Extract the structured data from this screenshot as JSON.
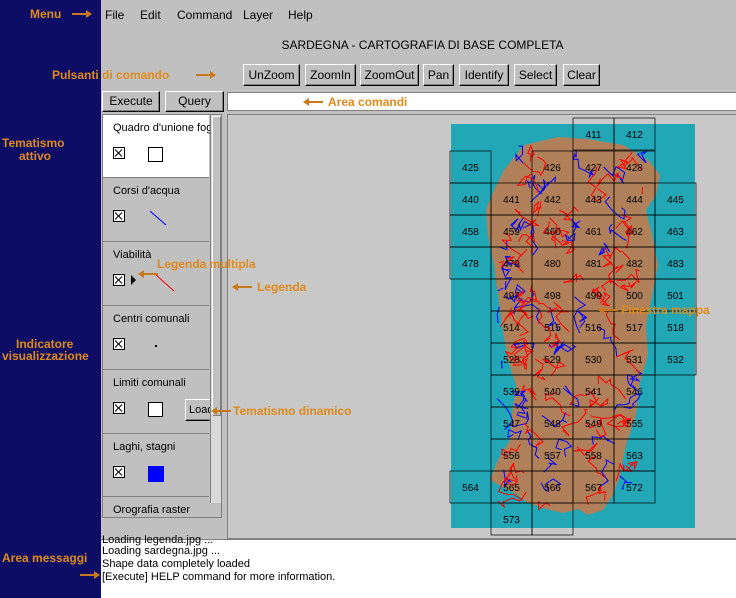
{
  "annotations": {
    "menu": "Menu",
    "pulsanti": "Pulsanti di comando",
    "area_comandi": "Area comandi",
    "tematismo_attivo_1": "Tematismo",
    "tematismo_attivo_2": "attivo",
    "legenda_multipla": "Legenda multipla",
    "legenda": "Legenda",
    "indicatore_1": "Indicatore",
    "indicatore_2": "visualizzazione",
    "tematismo_dinamico": "Tematismo dinamico",
    "finestra_mappa": "Finestra mappa",
    "area_messaggi": "Area messaggi"
  },
  "menubar": {
    "file": "File",
    "edit": "Edit",
    "command": "Command",
    "layer": "Layer",
    "help": "Help"
  },
  "map_title": "SARDEGNA - CARTOGRAFIA DI BASE COMPLETA",
  "toolbar": {
    "unzoom": "UnZoom",
    "zoomin": "ZoomIn",
    "zoomout": "ZoomOut",
    "pan": "Pan",
    "identify": "Identify",
    "select": "Select",
    "clear": "Clear"
  },
  "command_bar": {
    "execute": "Execute",
    "query": "Query",
    "input_value": ""
  },
  "legend": {
    "items": [
      {
        "label": "Quadro d'unione fogli"
      },
      {
        "label": "Corsi d'acqua"
      },
      {
        "label": "Viabilità"
      },
      {
        "label": "Centri comunali"
      },
      {
        "label": "Limiti comunali",
        "load_label": "Load"
      },
      {
        "label": "Laghi, stagni"
      },
      {
        "label": "Orografia raster"
      }
    ]
  },
  "map_sheets": [
    "411",
    "412",
    "425",
    "426",
    "427",
    "428",
    "440",
    "441",
    "442",
    "443",
    "444",
    "445",
    "458",
    "459",
    "460",
    "461",
    "462",
    "463",
    "478",
    "479",
    "480",
    "481",
    "482",
    "483",
    "497",
    "498",
    "499",
    "500",
    "501",
    "514",
    "515",
    "516",
    "517",
    "518",
    "528",
    "529",
    "530",
    "531",
    "532",
    "539",
    "540",
    "541",
    "546",
    "547",
    "548",
    "549",
    "555",
    "556",
    "557",
    "558",
    "563",
    "564",
    "565",
    "566",
    "567",
    "572",
    "573"
  ],
  "messages": {
    "line0": "Loading legenda.jpg ...",
    "line1": "Loading sardegna.jpg ...",
    "line2": "Shape data completely loaded",
    "line3": "[Execute] HELP command for more information."
  },
  "colors": {
    "annotation": "#e08a1e",
    "panel": "#0d0d66",
    "sea": "#22a7b7",
    "land": "#b0805a",
    "rivers": "#0000ff",
    "roads": "#ff0000",
    "lakes": "#0000ff"
  }
}
